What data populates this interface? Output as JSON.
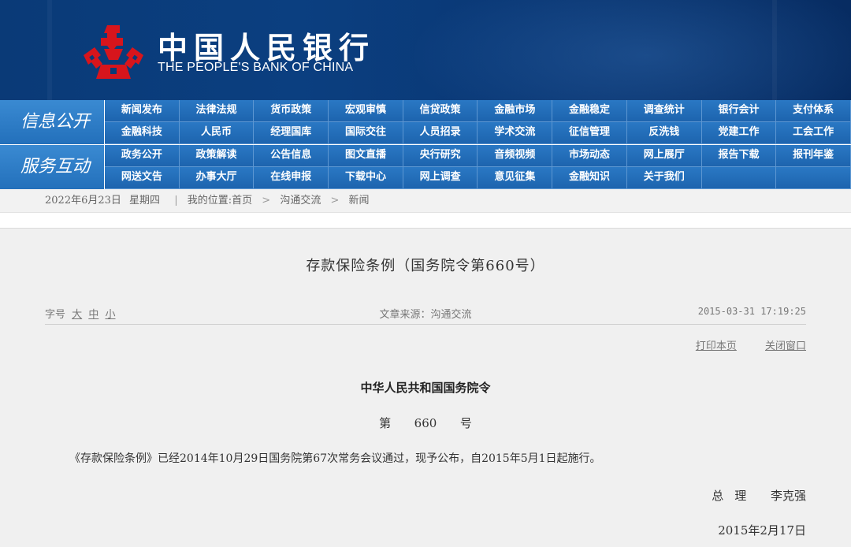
{
  "banner": {
    "title_cn": "中国人民银行",
    "title_en": "THE PEOPLE'S BANK OF CHINA",
    "emblem_icon": "pboc-emblem-icon",
    "emblem_color": "#d7151c",
    "background": "#0a3a77"
  },
  "nav": {
    "section1": {
      "label": "信息公开",
      "items": [
        "新闻发布",
        "法律法规",
        "货币政策",
        "宏观审慎",
        "信贷政策",
        "金融市场",
        "金融稳定",
        "调查统计",
        "银行会计",
        "支付体系",
        "金融科技",
        "人民币",
        "经理国库",
        "国际交往",
        "人员招录",
        "学术交流",
        "征信管理",
        "反洗钱",
        "党建工作",
        "工会工作"
      ]
    },
    "section2": {
      "label": "服务互动",
      "items": [
        "政务公开",
        "政策解读",
        "公告信息",
        "图文直播",
        "央行研究",
        "音频视频",
        "市场动态",
        "网上展厅",
        "报告下载",
        "报刊年鉴",
        "网送文告",
        "办事大厅",
        "在线申报",
        "下载中心",
        "网上调查",
        "意见征集",
        "金融知识",
        "关于我们",
        "",
        ""
      ]
    }
  },
  "breadcrumb": {
    "date": "2022年6月23日",
    "weekday": "星期四",
    "location_label": "我的位置:",
    "home": "首页",
    "level1": "沟通交流",
    "level2": "新闻",
    "separator": ">",
    "divider": "|"
  },
  "article": {
    "title": "存款保险条例（国务院令第660号）",
    "font_size_label": "字号",
    "font_large": "大",
    "font_medium": "中",
    "font_small": "小",
    "source": "文章来源：沟通交流",
    "datetime": "2015-03-31 17:19:25",
    "print": "打印本页",
    "close": "关闭窗口",
    "decree_head": "中华人民共和国国务院令",
    "decree_number": "第  660  号",
    "body": "《存款保险条例》已经2014年10月29日国务院第67次常务会议通过，现予公布，自2015年5月1日起施行。",
    "signer_role": "总理",
    "signer_name": "李克强",
    "sign_date": "2015年2月17日"
  }
}
